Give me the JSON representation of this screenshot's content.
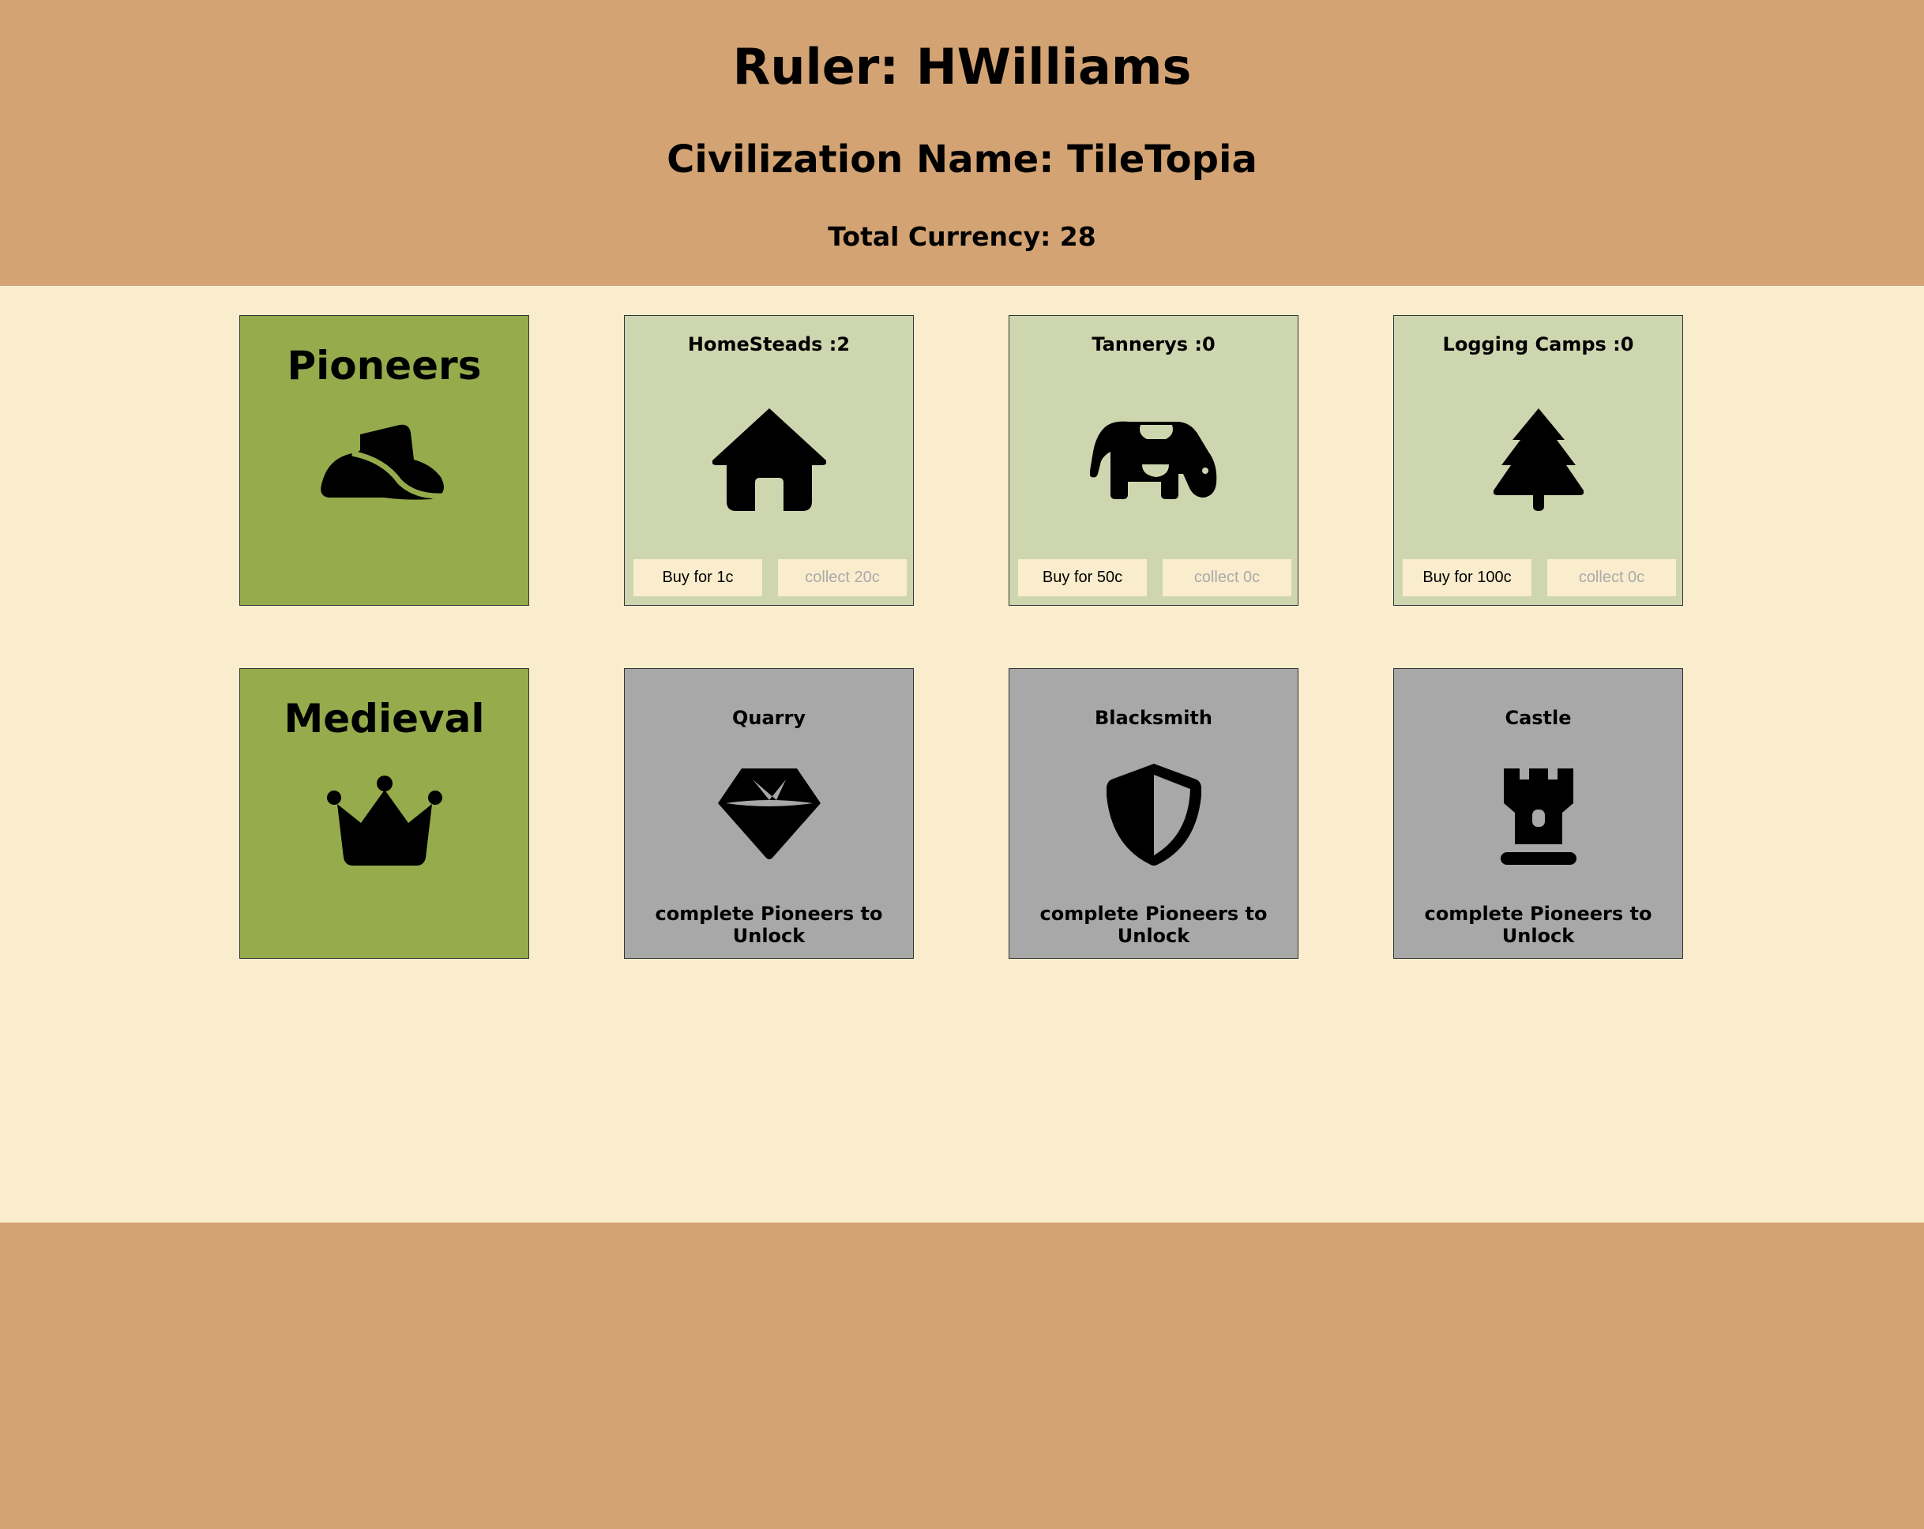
{
  "header": {
    "ruler": "Ruler: HWilliams",
    "civilization": "Civilization Name: TileTopia",
    "currency": "Total Currency: 28"
  },
  "colors": {
    "header_bg": "#d3a373",
    "main_bg": "#faedcd",
    "era_tile": "#96ab4b",
    "unlocked_tile": "#ced6b0",
    "locked_tile": "#a8a8a8"
  },
  "eras": [
    {
      "title": "Pioneers",
      "icon": "cowboy-hat-icon"
    },
    {
      "title": "Medieval",
      "icon": "crown-icon"
    }
  ],
  "pioneers": [
    {
      "title": "HomeSteads :2",
      "icon": "house-icon",
      "buy": "Buy for 1c",
      "collect": "collect 20c"
    },
    {
      "title": "Tannerys :0",
      "icon": "cow-icon",
      "buy": "Buy for 50c",
      "collect": "collect 0c"
    },
    {
      "title": "Logging Camps :0",
      "icon": "tree-icon",
      "buy": "Buy for 100c",
      "collect": "collect 0c"
    }
  ],
  "medieval": [
    {
      "title": "Quarry",
      "icon": "gem-icon",
      "status": "complete Pioneers to Unlock"
    },
    {
      "title": "Blacksmith",
      "icon": "shield-icon",
      "status": "complete Pioneers to Unlock"
    },
    {
      "title": "Castle",
      "icon": "chess-rook-icon",
      "status": "complete Pioneers to Unlock"
    }
  ]
}
